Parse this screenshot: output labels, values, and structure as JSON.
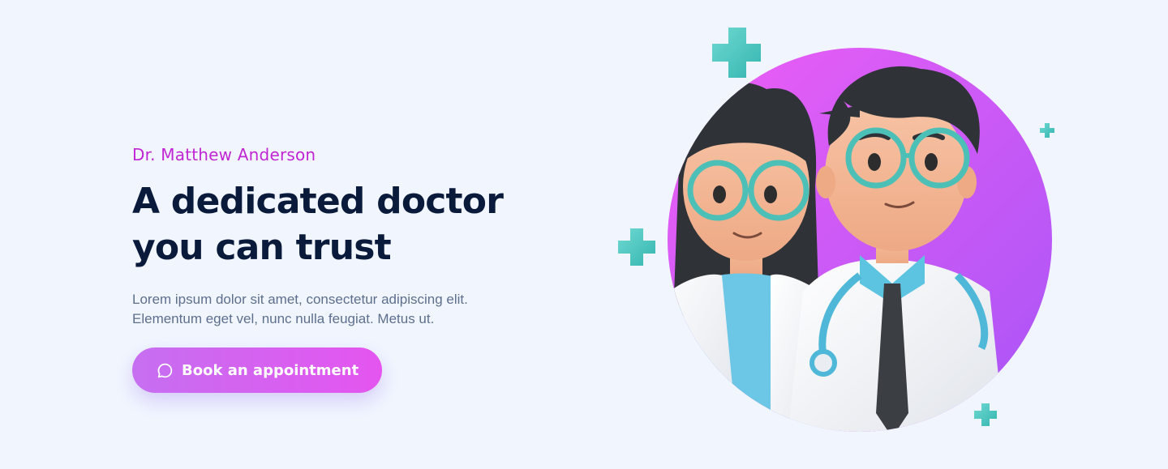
{
  "hero": {
    "eyebrow": "Dr. Matthew Anderson",
    "headline_line1": "A dedicated doctor",
    "headline_line2": "you can trust",
    "description_line1": "Lorem ipsum dolor sit amet, consectetur adipiscing elit.",
    "description_line2": "Elementum eget vel, nunc nulla feugiat. Metus ut.",
    "cta_label": "Book an appointment",
    "cta_icon": "chat-bubble-icon"
  },
  "illustration": {
    "subject": "two cartoon doctors with glasses",
    "icons": [
      "medical-cross-icon"
    ]
  },
  "colors": {
    "background": "#f1f6fe",
    "accent": "#c026d3",
    "headline": "#0a1a3a",
    "body_text": "#5d6f8d",
    "cta_start": "#c66ff1",
    "cta_end": "#e455ef",
    "cross": "#4cc9c4",
    "circle_start": "#e85cf3",
    "circle_end": "#a855f7"
  }
}
